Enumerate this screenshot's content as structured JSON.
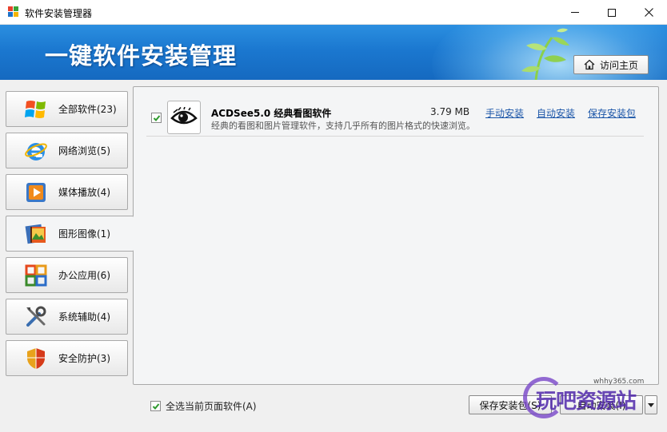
{
  "window": {
    "title": "软件安装管理器",
    "minimize_icon": "minimize-icon",
    "maximize_icon": "maximize-icon",
    "close_icon": "close-icon"
  },
  "banner": {
    "title": "一键软件安装管理",
    "home_button": "访问主页",
    "home_icon": "home-icon"
  },
  "sidebar": {
    "items": [
      {
        "label": "全部软件(23)",
        "icon": "windows-logo-icon"
      },
      {
        "label": "网络浏览(5)",
        "icon": "internet-explorer-icon"
      },
      {
        "label": "媒体播放(4)",
        "icon": "media-player-icon"
      },
      {
        "label": "图形图像(1)",
        "icon": "image-film-icon",
        "active": true
      },
      {
        "label": "办公应用(6)",
        "icon": "office-icon"
      },
      {
        "label": "系统辅助(4)",
        "icon": "tools-icon"
      },
      {
        "label": "安全防护(3)",
        "icon": "shield-icon"
      }
    ]
  },
  "software": [
    {
      "name": "ACDSee5.0 经典看图软件",
      "description": "经典的看图和图片管理软件，支持几乎所有的图片格式的快速浏览。",
      "size": "3.79 MB",
      "checked": true,
      "icon": "eye-icon",
      "links": {
        "manual": "手动安装",
        "auto": "自动安装",
        "save": "保存安装包"
      }
    }
  ],
  "footer": {
    "select_all_label": "全选当前页面软件(A)",
    "select_all_checked": true,
    "save_button": "保存安装包(S)",
    "auto_button": "自动安装(I)"
  },
  "watermark": {
    "text": "玩吧资源站",
    "url": "whhy365.com"
  },
  "colors": {
    "banner_blue": "#1b78d0",
    "link_blue": "#1a55a8",
    "check_green": "#2f9a2f"
  }
}
